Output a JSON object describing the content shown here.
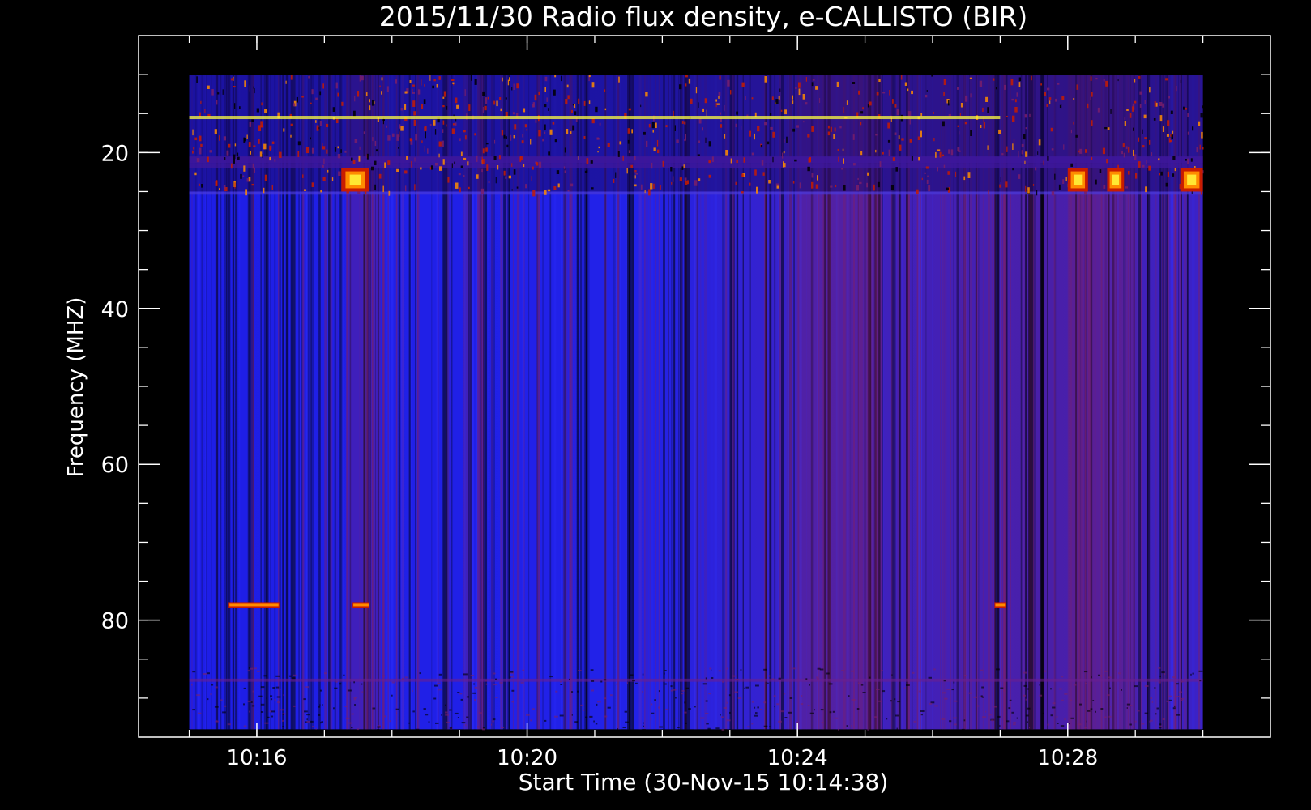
{
  "chart_data": {
    "type": "heatmap",
    "title": "2015/11/30  Radio flux density, e-CALLISTO (BIR)",
    "xlabel": "Start Time (30-Nov-15 10:14:38)",
    "ylabel": "Frequency (MHZ)",
    "x_start": "10:15:00",
    "x_end": "10:30:00",
    "xlim": [
      "10:14:15",
      "10:31:00"
    ],
    "ylim": [
      95,
      5
    ],
    "y_inverted": true,
    "data_frequency_range_mhz": [
      10,
      94
    ],
    "x_ticks": [
      "10:16",
      "10:20",
      "10:24",
      "10:28"
    ],
    "x_minor_ticks": [
      "10:15",
      "10:16",
      "10:17",
      "10:18",
      "10:19",
      "10:20",
      "10:21",
      "10:22",
      "10:23",
      "10:24",
      "10:25",
      "10:26",
      "10:27",
      "10:28",
      "10:29",
      "10:30"
    ],
    "y_ticks": [
      20,
      40,
      60,
      80
    ],
    "y_minor_ticks": [
      10,
      15,
      20,
      25,
      30,
      35,
      40,
      45,
      50,
      55,
      60,
      65,
      70,
      75,
      80,
      85,
      90
    ],
    "colormap": [
      "#000000",
      "#1414ff",
      "#7a1f6a",
      "#c81c00",
      "#ff8c00",
      "#ffff40"
    ],
    "background_color": "#1c1cd8",
    "grid": false,
    "legend": "none",
    "features": [
      {
        "kind": "interference band",
        "freq_mhz": [
          10,
          25
        ],
        "time": [
          "10:15:00",
          "10:30:00"
        ]
      },
      {
        "kind": "narrowband line",
        "freq_mhz": 15.5,
        "time": [
          "10:15:00",
          "10:27:00"
        ]
      },
      {
        "kind": "burst",
        "freq_mhz": [
          22,
          25
        ],
        "time": [
          "10:28:00",
          "10:28:18"
        ]
      },
      {
        "kind": "burst",
        "freq_mhz": [
          22,
          25
        ],
        "time": [
          "10:28:35",
          "10:28:50"
        ]
      },
      {
        "kind": "burst",
        "freq_mhz": [
          22,
          25
        ],
        "time": [
          "10:29:40",
          "10:30:00"
        ]
      },
      {
        "kind": "burst",
        "freq_mhz": [
          22,
          25
        ],
        "time": [
          "10:17:15",
          "10:17:40"
        ]
      },
      {
        "kind": "spike",
        "freq_mhz": 78,
        "time": [
          "10:15:35",
          "10:16:20"
        ]
      },
      {
        "kind": "spike",
        "freq_mhz": 78,
        "time": [
          "10:17:25",
          "10:17:40"
        ]
      },
      {
        "kind": "spike",
        "freq_mhz": 78,
        "time": [
          "10:26:55",
          "10:27:05"
        ]
      }
    ]
  }
}
